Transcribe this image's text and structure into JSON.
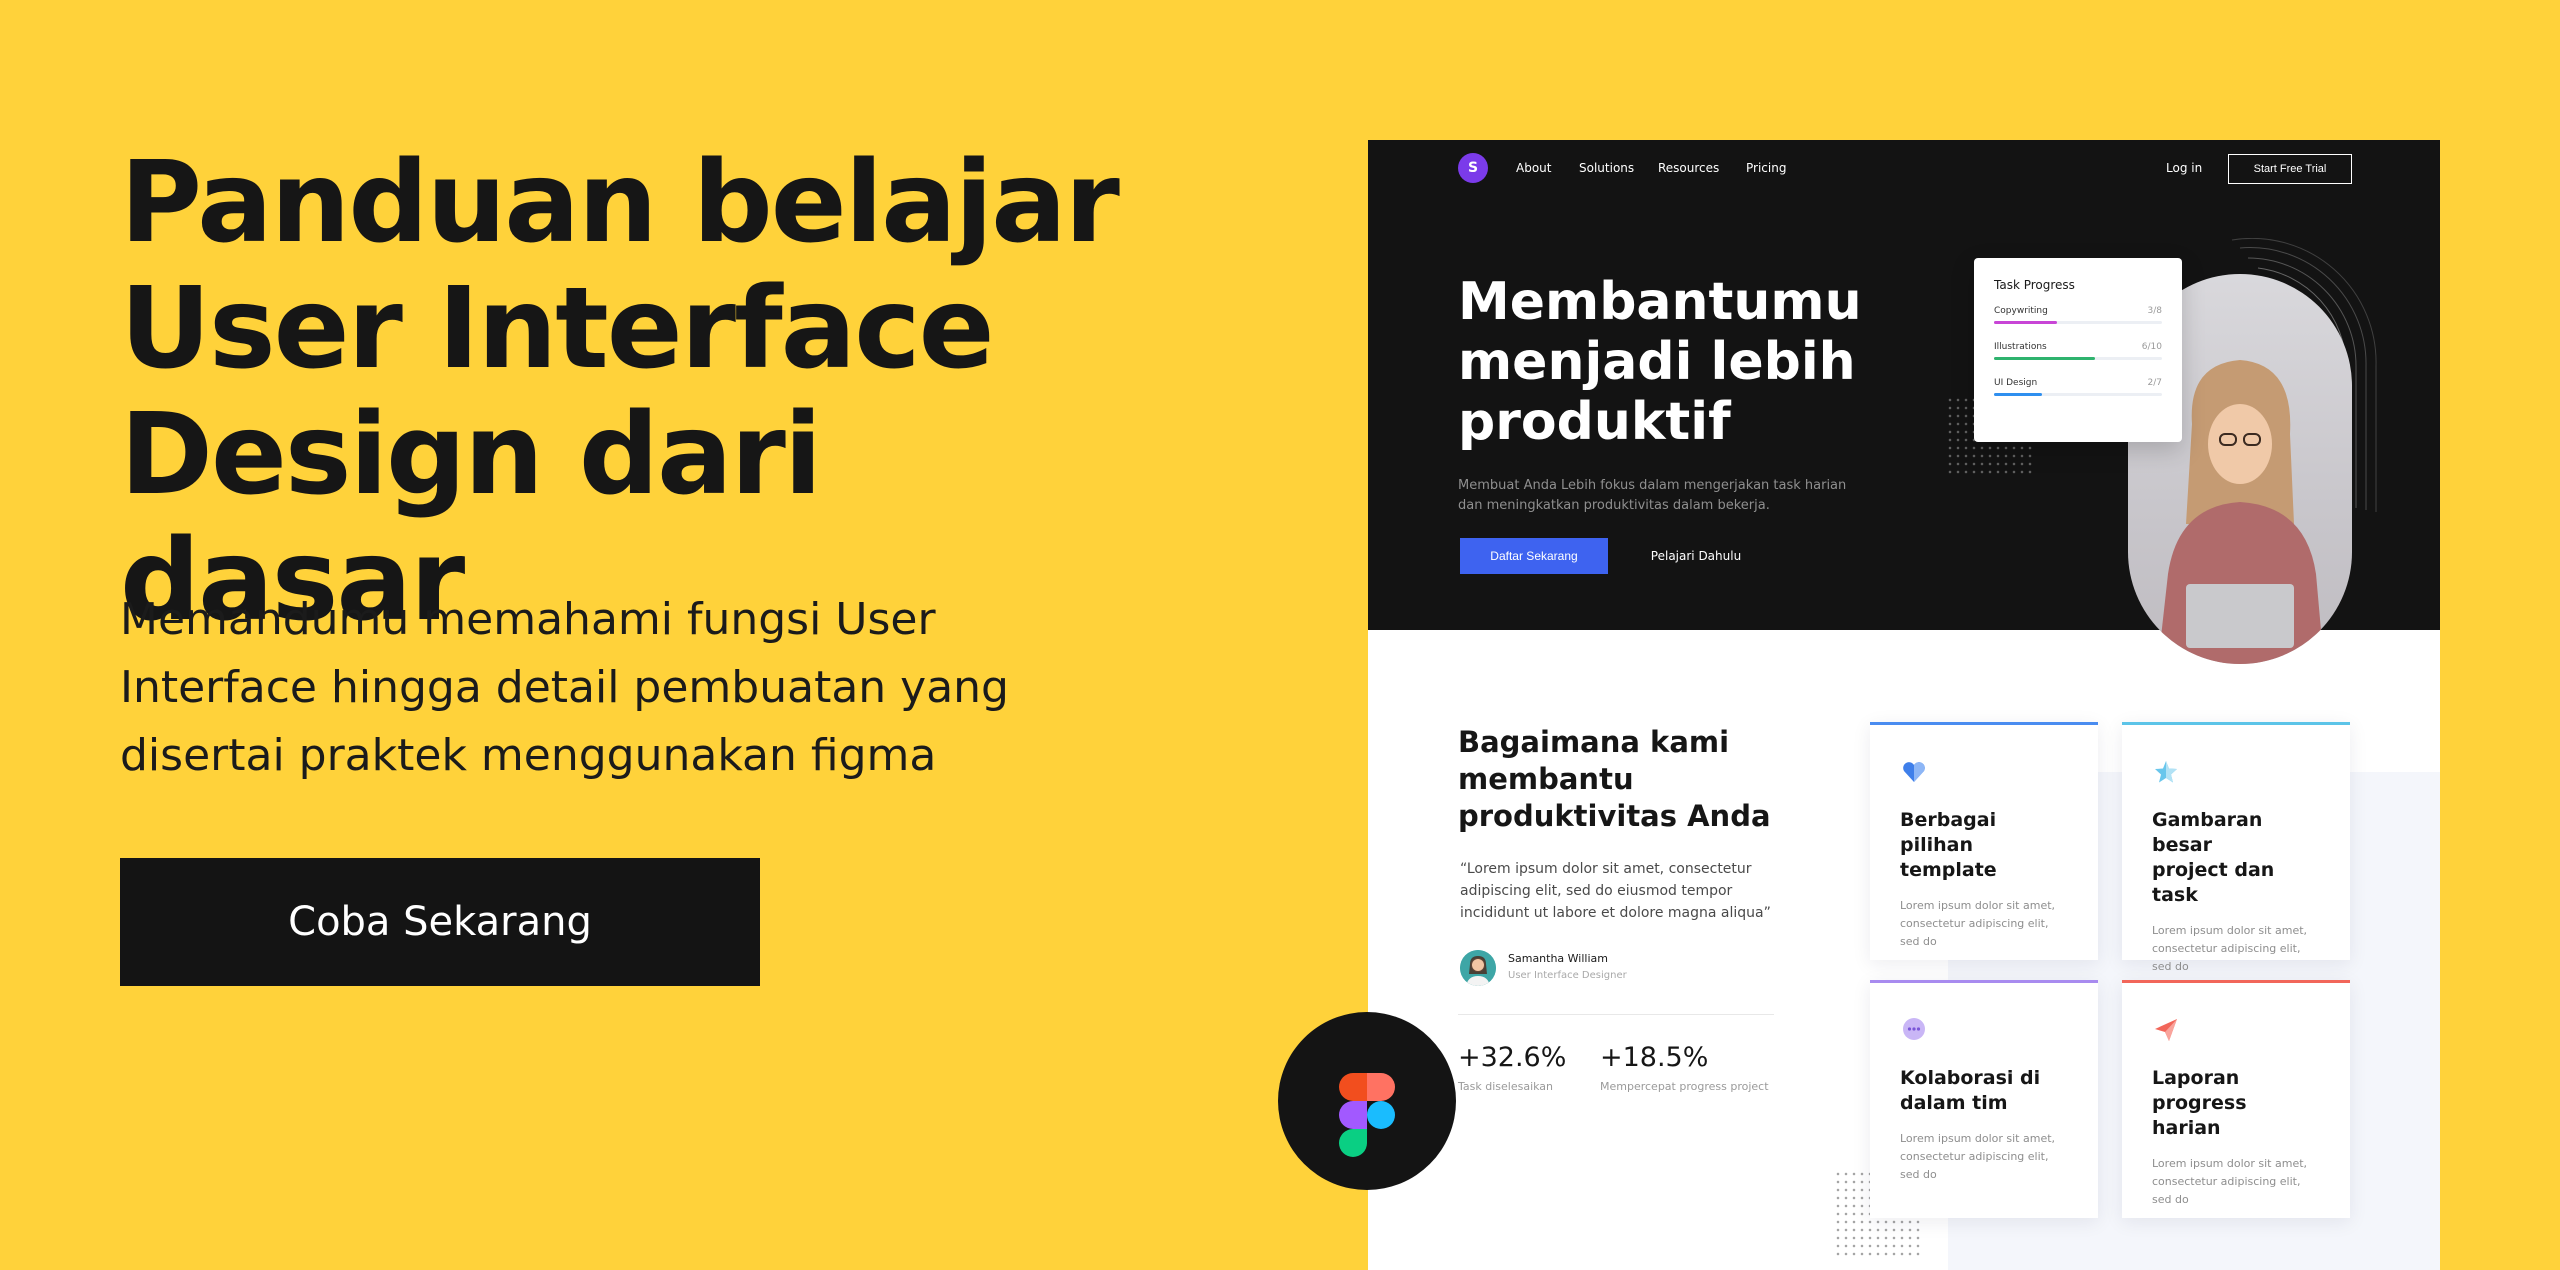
{
  "promo": {
    "title": "Panduan belajar\nUser Interface\nDesign dari dasar",
    "subtitle": "Memandumu memahami fungsi User\nInterface hingga detail pembuatan yang\ndisertai praktek menggunakan figma",
    "cta_label": "Coba Sekarang"
  },
  "colors": {
    "background": "#FFD23A",
    "dark": "#141414",
    "accent_blue": "#3E63F0",
    "logo_purple": "#7B3BEA"
  },
  "mockup": {
    "nav": {
      "logo": "S",
      "links": [
        "About",
        "Solutions",
        "Resources",
        "Pricing"
      ],
      "login": "Log in",
      "trial_button": "Start Free Trial"
    },
    "hero": {
      "title": "Membantumu\nmenjadi lebih\nproduktif",
      "description": "Membuat Anda Lebih fokus dalam mengerjakan task harian\ndan meningkatkan produktivitas dalam bekerja.",
      "primary_button": "Daftar Sekarang",
      "secondary_button": "Pelajari Dahulu"
    },
    "task_progress": {
      "title": "Task Progress",
      "items": [
        {
          "label": "Copywriting",
          "count": "3/8",
          "progress": 0.375,
          "color": "#C845D6"
        },
        {
          "label": "Illustrations",
          "count": "6/10",
          "progress": 0.6,
          "color": "#2FB36E"
        },
        {
          "label": "UI Design",
          "count": "2/7",
          "progress": 0.286,
          "color": "#2F8FEF"
        }
      ]
    },
    "how": {
      "title": "Bagaimana kami\nmembantu\nproduktivitas Anda",
      "quote": "“Lorem ipsum dolor sit amet, consectetur\nadipiscing elit, sed do eiusmod tempor\nincididunt ut labore et dolore magna aliqua”",
      "author_name": "Samantha William",
      "author_role": "User Interface Designer",
      "stats": [
        {
          "value": "+32.6%",
          "label": "Task diselesaikan"
        },
        {
          "value": "+18.5%",
          "label": "Mempercepat progress project"
        }
      ]
    },
    "features": [
      {
        "icon": "heart-icon",
        "title": "Berbagai pilihan\ntemplate",
        "desc": "Lorem ipsum dolor sit amet,\nconsectetur adipiscing elit,\nsed do",
        "accent": "#4A8CF0"
      },
      {
        "icon": "star-icon",
        "title": "Gambaran besar\nproject dan task",
        "desc": "Lorem ipsum dolor sit amet,\nconsectetur adipiscing elit,\nsed do",
        "accent": "#5CC4E8"
      },
      {
        "icon": "chat-bubble-icon",
        "title": "Kolaborasi di\ndalam tim",
        "desc": "Lorem ipsum dolor sit amet,\nconsectetur adipiscing elit,\nsed do",
        "accent": "#A88BEF"
      },
      {
        "icon": "send-icon",
        "title": "Laporan progress\nharian",
        "desc": "Lorem ipsum dolor sit amet,\nconsectetur adipiscing elit,\nsed do",
        "accent": "#F2665A"
      }
    ]
  },
  "badge": {
    "icon": "figma-logo-icon"
  }
}
